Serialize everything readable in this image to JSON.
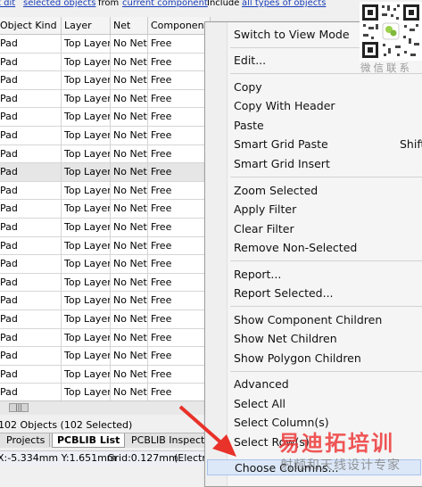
{
  "toolbar": {
    "edit_link": "t dit",
    "selected_objects_link": "selected objects",
    "from_label": "from",
    "current_component_link": "current component",
    "include_label": "Include",
    "all_types_link": "all types of objects"
  },
  "grid": {
    "columns": [
      "Object Kind",
      "Layer",
      "Net",
      "Component"
    ],
    "rows": [
      {
        "kind": "Pad",
        "layer": "Top Layer",
        "net": "No Net",
        "component": "Free"
      },
      {
        "kind": "Pad",
        "layer": "Top Layer",
        "net": "No Net",
        "component": "Free"
      },
      {
        "kind": "Pad",
        "layer": "Top Layer",
        "net": "No Net",
        "component": "Free"
      },
      {
        "kind": "Pad",
        "layer": "Top Layer",
        "net": "No Net",
        "component": "Free"
      },
      {
        "kind": "Pad",
        "layer": "Top Layer",
        "net": "No Net",
        "component": "Free"
      },
      {
        "kind": "Pad",
        "layer": "Top Layer",
        "net": "No Net",
        "component": "Free"
      },
      {
        "kind": "Pad",
        "layer": "Top Layer",
        "net": "No Net",
        "component": "Free"
      },
      {
        "kind": "Pad",
        "layer": "Top Layer",
        "net": "No Net",
        "component": "Free"
      },
      {
        "kind": "Pad",
        "layer": "Top Layer",
        "net": "No Net",
        "component": "Free"
      },
      {
        "kind": "Pad",
        "layer": "Top Layer",
        "net": "No Net",
        "component": "Free"
      },
      {
        "kind": "Pad",
        "layer": "Top Layer",
        "net": "No Net",
        "component": "Free"
      },
      {
        "kind": "Pad",
        "layer": "Top Layer",
        "net": "No Net",
        "component": "Free"
      },
      {
        "kind": "Pad",
        "layer": "Top Layer",
        "net": "No Net",
        "component": "Free"
      },
      {
        "kind": "Pad",
        "layer": "Top Layer",
        "net": "No Net",
        "component": "Free"
      },
      {
        "kind": "Pad",
        "layer": "Top Layer",
        "net": "No Net",
        "component": "Free"
      },
      {
        "kind": "Pad",
        "layer": "Top Layer",
        "net": "No Net",
        "component": "Free"
      },
      {
        "kind": "Pad",
        "layer": "Top Layer",
        "net": "No Net",
        "component": "Free"
      },
      {
        "kind": "Pad",
        "layer": "Top Layer",
        "net": "No Net",
        "component": "Free"
      },
      {
        "kind": "Pad",
        "layer": "Top Layer",
        "net": "No Net",
        "component": "Free"
      },
      {
        "kind": "Pad",
        "layer": "Top Layer",
        "net": "No Net",
        "component": "Free"
      },
      {
        "kind": "Pad",
        "layer": "Top Layer",
        "net": "No Net",
        "component": "Free"
      }
    ]
  },
  "scroll_thumb": "|||",
  "status": "102 Objects (102 Selected)",
  "tabs": [
    "Projects",
    "PCBLIB List",
    "PCBLIB Inspector"
  ],
  "status_bar": {
    "coords": "X:-5.334mm Y:1.651mm",
    "grid": "Grid:0.127mm",
    "electrical": "(Electri"
  },
  "menu": {
    "items": [
      {
        "label": "Switch to View Mode"
      },
      {
        "label": "Edit..."
      },
      {
        "label": "Copy"
      },
      {
        "label": "Copy With Header"
      },
      {
        "label": "Paste"
      },
      {
        "label": "Smart Grid Paste",
        "shortcut": "Shift"
      },
      {
        "label": "Smart Grid Insert"
      },
      {
        "label": "Zoom Selected"
      },
      {
        "label": "Apply Filter"
      },
      {
        "label": "Clear Filter"
      },
      {
        "label": "Remove Non-Selected"
      },
      {
        "label": "Report..."
      },
      {
        "label": "Report Selected..."
      },
      {
        "label": "Show Component Children"
      },
      {
        "label": "Show Net Children"
      },
      {
        "label": "Show Polygon Children"
      },
      {
        "label": "Advanced"
      },
      {
        "label": "Select All"
      },
      {
        "label": "Select Column(s)"
      },
      {
        "label": "Select Row(s)"
      },
      {
        "label": "Choose Columns..."
      }
    ]
  },
  "watermark": {
    "qr_label": "微信联系",
    "brand": "易迪拓培训",
    "tagline": "射频和天线设计专家"
  },
  "colors": {
    "link": "#1a3fb8",
    "arrow": "#e8322a",
    "brand": "#ee3a3a",
    "menu_highlight": "#dce8f8"
  }
}
